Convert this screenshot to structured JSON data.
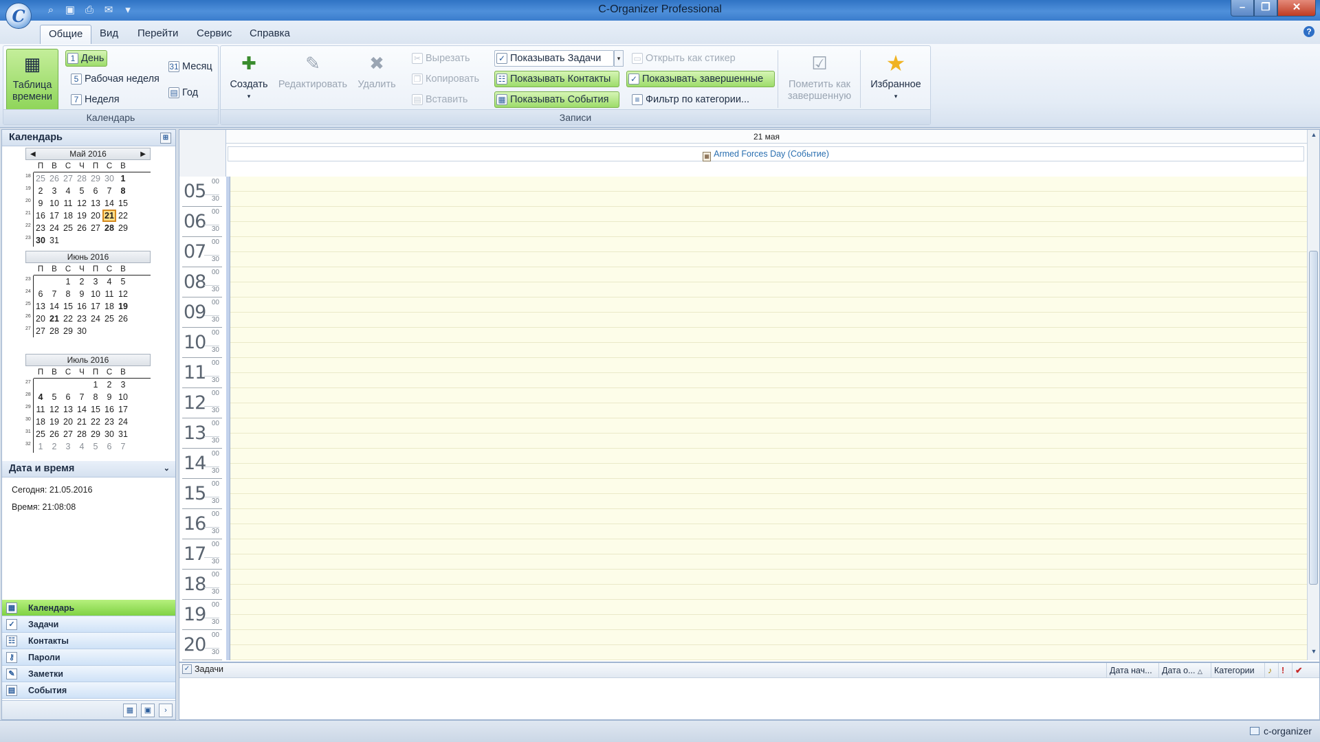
{
  "window": {
    "title": "C-Organizer Professional",
    "logo_letter": "C"
  },
  "ribbon": {
    "tabs": [
      "Общие",
      "Вид",
      "Перейти",
      "Сервис",
      "Справка"
    ],
    "calendar_group": {
      "label": "Календарь",
      "timetable": "Таблица времени",
      "day": "День",
      "work_week": "Рабочая неделя",
      "week": "Неделя",
      "month": "Месяц",
      "year": "Год"
    },
    "records_group": {
      "label": "Записи",
      "create": "Создать",
      "edit": "Редактировать",
      "delete": "Удалить",
      "cut": "Вырезать",
      "copy": "Копировать",
      "paste": "Вставить",
      "show_tasks": "Показывать Задачи",
      "show_contacts": "Показывать Контакты",
      "show_events": "Показывать События",
      "open_as_sticker": "Открыть как стикер",
      "show_completed": "Показывать завершенные",
      "filter_by_category": "Фильтр по категории...",
      "mark_completed": "Пометить как завершенную",
      "favorites": "Избранное"
    }
  },
  "left_panel": {
    "calendar_title": "Календарь",
    "dow": [
      "П",
      "В",
      "С",
      "Ч",
      "П",
      "С",
      "В"
    ],
    "months": [
      {
        "title": "Май 2016",
        "weeks": [
          {
            "wn": "18",
            "days": [
              "25",
              "26",
              "27",
              "28",
              "29",
              "30",
              "1"
            ]
          },
          {
            "wn": "19",
            "days": [
              "2",
              "3",
              "4",
              "5",
              "6",
              "7",
              "8"
            ]
          },
          {
            "wn": "20",
            "days": [
              "9",
              "10",
              "11",
              "12",
              "13",
              "14",
              "15"
            ]
          },
          {
            "wn": "21",
            "days": [
              "16",
              "17",
              "18",
              "19",
              "20",
              "21",
              "22"
            ]
          },
          {
            "wn": "22",
            "days": [
              "23",
              "24",
              "25",
              "26",
              "27",
              "28",
              "29"
            ]
          },
          {
            "wn": "23",
            "days": [
              "30",
              "31",
              "",
              "",
              "",
              "",
              ""
            ]
          }
        ]
      },
      {
        "title": "Июнь 2016",
        "weeks": [
          {
            "wn": "23",
            "days": [
              "",
              "",
              "1",
              "2",
              "3",
              "4",
              "5"
            ]
          },
          {
            "wn": "24",
            "days": [
              "6",
              "7",
              "8",
              "9",
              "10",
              "11",
              "12"
            ]
          },
          {
            "wn": "25",
            "days": [
              "13",
              "14",
              "15",
              "16",
              "17",
              "18",
              "19"
            ]
          },
          {
            "wn": "26",
            "days": [
              "20",
              "21",
              "22",
              "23",
              "24",
              "25",
              "26"
            ]
          },
          {
            "wn": "27",
            "days": [
              "27",
              "28",
              "29",
              "30",
              "",
              "",
              ""
            ]
          }
        ]
      },
      {
        "title": "Июль 2016",
        "weeks": [
          {
            "wn": "27",
            "days": [
              "",
              "",
              "",
              "",
              "1",
              "2",
              "3"
            ]
          },
          {
            "wn": "28",
            "days": [
              "4",
              "5",
              "6",
              "7",
              "8",
              "9",
              "10"
            ]
          },
          {
            "wn": "29",
            "days": [
              "11",
              "12",
              "13",
              "14",
              "15",
              "16",
              "17"
            ]
          },
          {
            "wn": "30",
            "days": [
              "18",
              "19",
              "20",
              "21",
              "22",
              "23",
              "24"
            ]
          },
          {
            "wn": "31",
            "days": [
              "25",
              "26",
              "27",
              "28",
              "29",
              "30",
              "31"
            ]
          },
          {
            "wn": "32",
            "days": [
              "1",
              "2",
              "3",
              "4",
              "5",
              "6",
              "7"
            ]
          }
        ]
      }
    ],
    "datetime_title": "Дата и время",
    "today": "Сегодня: 21.05.2016",
    "time": "Время: 21:08:08",
    "nav_items": [
      "Календарь",
      "Задачи",
      "Контакты",
      "Пароли",
      "Заметки",
      "События"
    ]
  },
  "day_view": {
    "date_label": "21 мая",
    "event": "Armed Forces Day (Событие)",
    "hours": [
      "05",
      "06",
      "07",
      "08",
      "09",
      "10",
      "11",
      "12",
      "13",
      "14",
      "15",
      "16",
      "17",
      "18",
      "19",
      "20"
    ],
    "min_00": "00",
    "min_30": "30"
  },
  "tasks_pane": {
    "title": "Задачи",
    "columns": [
      "Дата нач...",
      "Дата о...",
      "Категории"
    ]
  },
  "statusbar": {
    "text": "c-organizer"
  }
}
